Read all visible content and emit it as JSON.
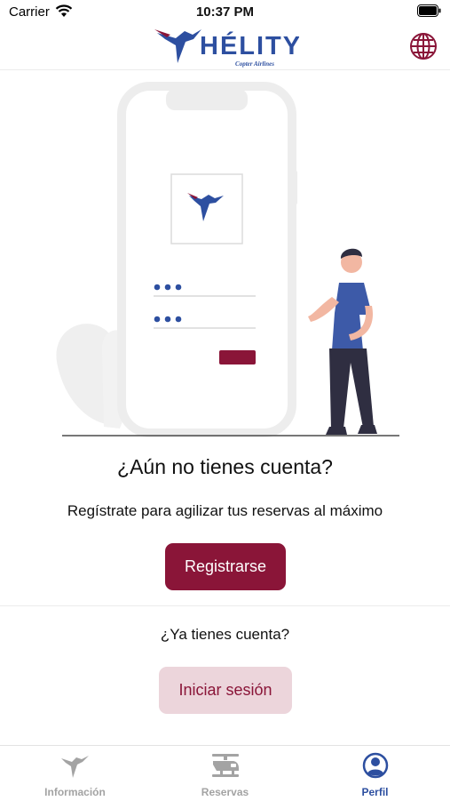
{
  "status_bar": {
    "carrier": "Carrier",
    "time": "10:37 PM"
  },
  "header": {
    "logo_text": "HÉLITY",
    "logo_subtitle": "Copter Airlines"
  },
  "main": {
    "headline": "¿Aún no tienes cuenta?",
    "subline": "Regístrate para agilizar tus reservas al máximo",
    "register_label": "Registrarse",
    "question": "¿Ya tienes cuenta?",
    "login_label": "Iniciar sesión"
  },
  "tabs": [
    {
      "label": "Información",
      "icon": "hummingbird-icon",
      "active": false
    },
    {
      "label": "Reservas",
      "icon": "helicopter-icon",
      "active": false
    },
    {
      "label": "Perfil",
      "icon": "profile-icon",
      "active": true
    }
  ],
  "colors": {
    "brand": "#8a1538",
    "brand_light": "#ecd5db",
    "blue": "#2d4fa0",
    "inactive": "#a3a3a3"
  }
}
